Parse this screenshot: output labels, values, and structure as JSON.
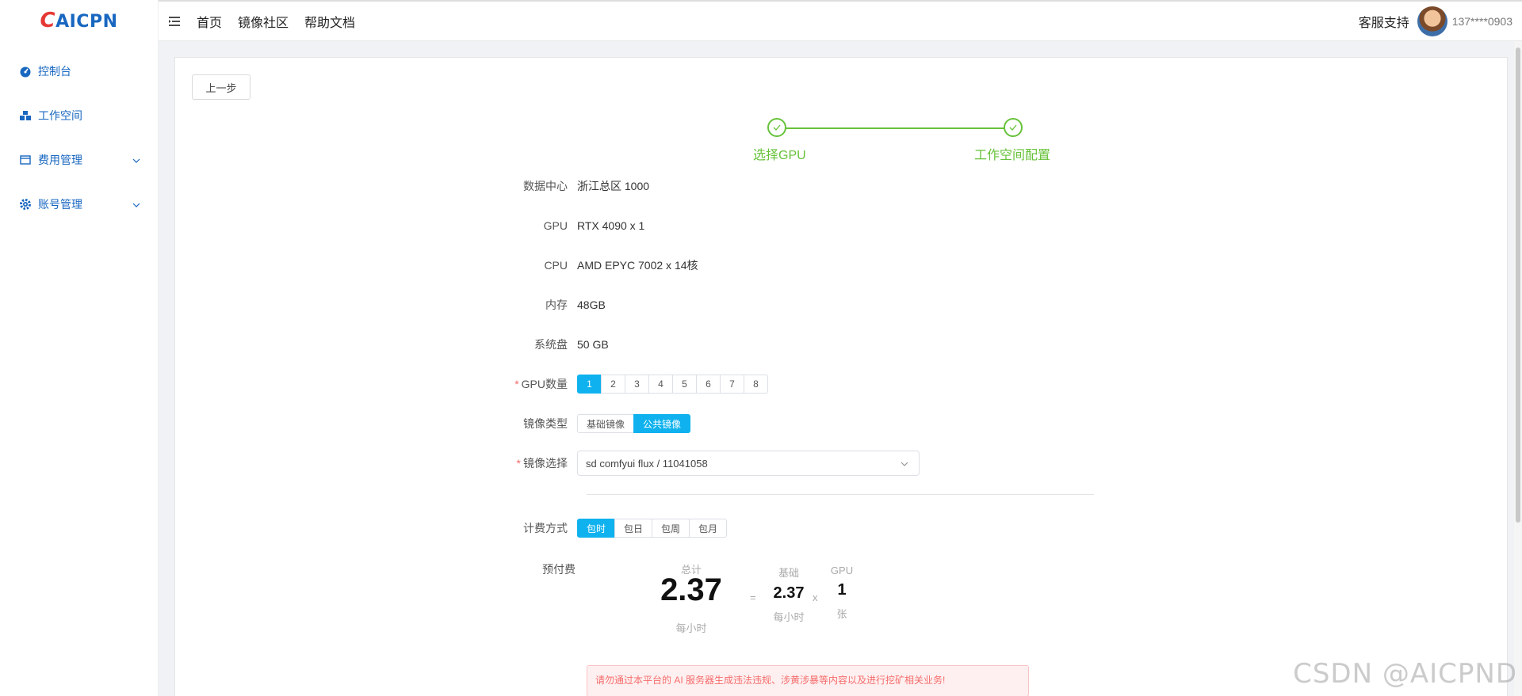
{
  "app": {
    "logo_text": "AICPN",
    "brand_color": "#1867c0"
  },
  "sidebar": {
    "items": [
      {
        "label": "控制台",
        "icon": "dashboard-icon"
      },
      {
        "label": "工作空间",
        "icon": "workspace-icon"
      },
      {
        "label": "费用管理",
        "icon": "billing-icon",
        "expandable": true
      },
      {
        "label": "账号管理",
        "icon": "gear-icon",
        "expandable": true
      }
    ]
  },
  "header": {
    "nav": [
      "首页",
      "镜像社区",
      "帮助文档"
    ],
    "support_label": "客服支持",
    "user": "137****0903"
  },
  "page": {
    "back_label": "上一步",
    "steps": [
      {
        "label": "选择GPU",
        "status": "done"
      },
      {
        "label": "工作空间配置",
        "status": "done"
      }
    ],
    "fields": {
      "datacenter_label": "数据中心",
      "datacenter": "浙江总区 1000",
      "gpu_label": "GPU",
      "gpu": "RTX 4090 x 1",
      "cpu_label": "CPU",
      "cpu": "AMD EPYC 7002 x 14核",
      "mem_label": "内存",
      "mem": "48GB",
      "disk_label": "系统盘",
      "disk": "50 GB"
    },
    "gpu_count": {
      "label": "GPU数量",
      "required_mark": "*",
      "options": [
        "1",
        "2",
        "3",
        "4",
        "5",
        "6",
        "7",
        "8"
      ],
      "selected": "1"
    },
    "image_type": {
      "label": "镜像类型",
      "options": [
        "基础镜像",
        "公共镜像"
      ],
      "selected": "公共镜像"
    },
    "image_select": {
      "label": "镜像选择",
      "required_mark": "*",
      "value": "sd comfyui flux / 11041058"
    },
    "billing": {
      "label": "计费方式",
      "options": [
        "包时",
        "包日",
        "包周",
        "包月"
      ],
      "selected": "包时"
    },
    "prepay": {
      "label": "预付费",
      "total_caption": "总计",
      "total": "2.37",
      "total_unit": "每小时",
      "equals": "=",
      "base_caption": "基础",
      "base": "2.37",
      "base_unit": "每小时",
      "times": "x",
      "gpu_caption": "GPU",
      "gpu_count": "1",
      "gpu_unit": "张"
    },
    "warning": "请勿通过本平台的 AI 服务器生成违法违规、涉黄涉暴等内容以及进行挖矿相关业务!",
    "accent_color": "#0fb2ee",
    "success_color": "#67c23a"
  },
  "watermark": "CSDN @AICPND"
}
